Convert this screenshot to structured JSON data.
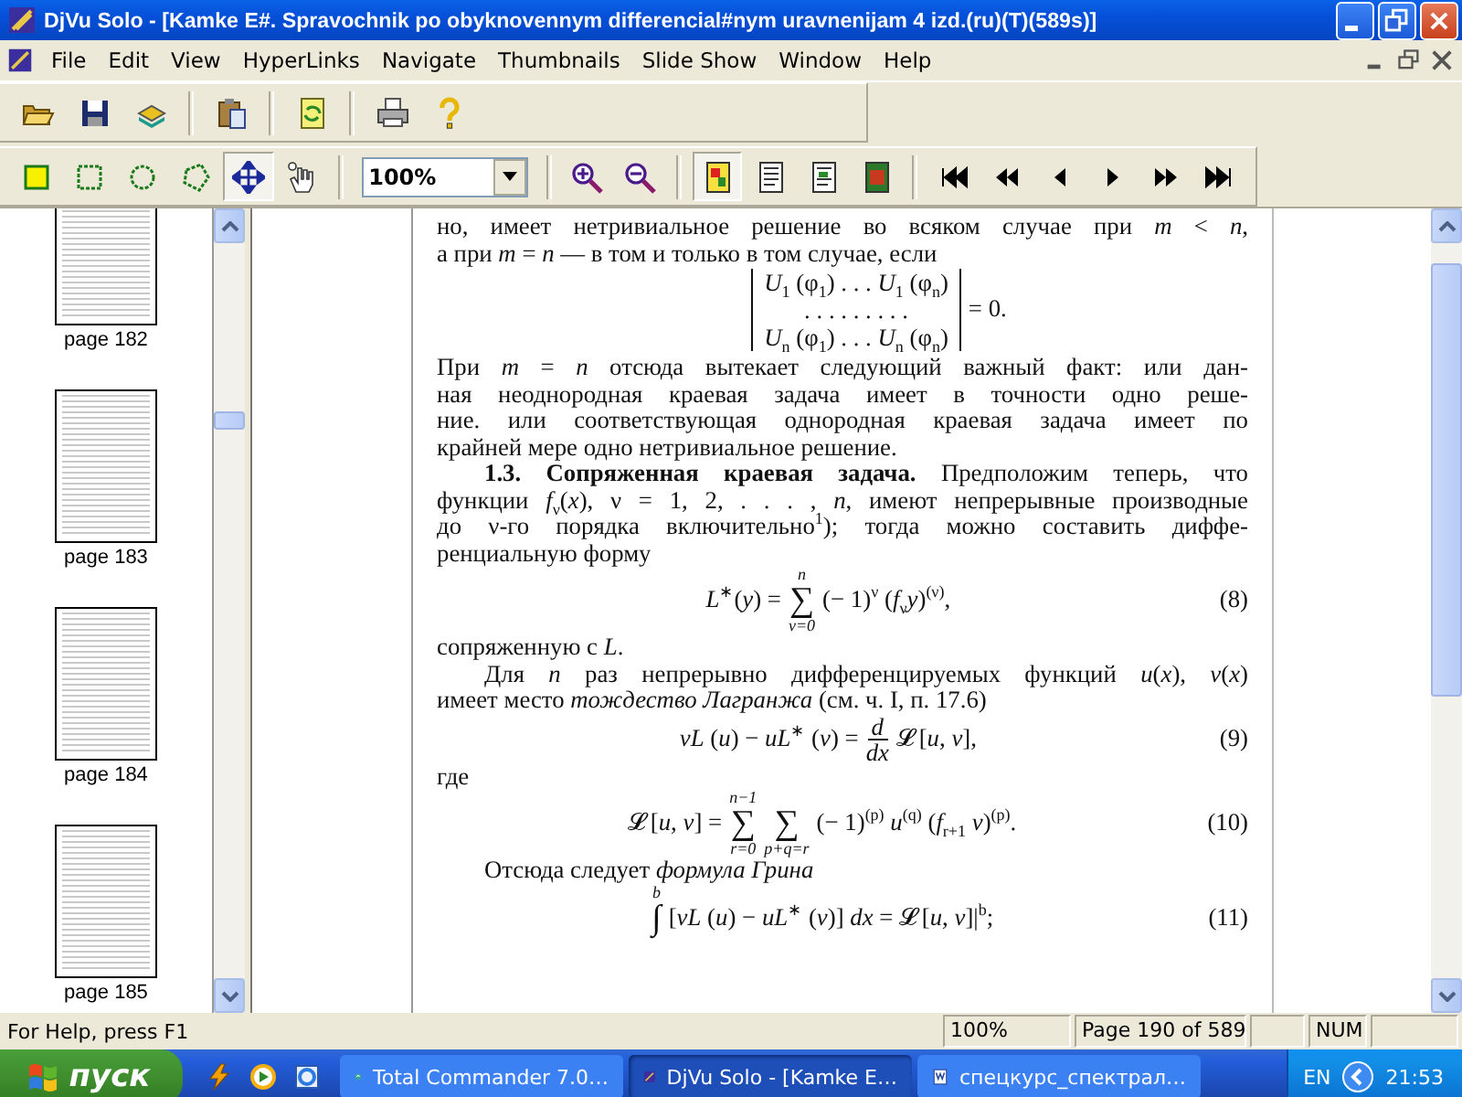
{
  "window": {
    "title": "DjVu Solo - [Kamke E#. Spravochnik po obyknovennym differencial#nym uravnenijam 4 izd.(ru)(T)(589s)]"
  },
  "menu": [
    "File",
    "Edit",
    "View",
    "HyperLinks",
    "Navigate",
    "Thumbnails",
    "Slide Show",
    "Window",
    "Help"
  ],
  "tools": [
    {
      "selected": false
    },
    {
      "selected": false
    },
    {
      "selected": false
    },
    {
      "selected": false
    },
    {
      "selected": true
    },
    {
      "selected": false
    }
  ],
  "zoom_box": {
    "value": "100%"
  },
  "view_modes": [
    {
      "selected": true
    },
    {
      "selected": false
    },
    {
      "selected": false
    },
    {
      "selected": false
    }
  ],
  "thumbnails": [
    {
      "label": "page 182"
    },
    {
      "label": "page 183"
    },
    {
      "label": "page 184"
    },
    {
      "label": "page 185"
    }
  ],
  "document": {
    "blocks": [
      {
        "kind": "para",
        "indent": false,
        "lines": [
          "но, имеет нетривиальное решение во всяком случае при *m* < *n*,",
          "а при *m* = *n* — в том и только в том случае, если"
        ]
      },
      {
        "kind": "det",
        "rows": [
          "*U*$_{1}$ (φ$_{1}$) . . . *U*$_{1}$ (φ$_{n}$)",
          ". . . . . . . . .",
          "*U*$_{n}$ (φ$_{1}$) . . . *U*$_{n}$ (φ$_{n}$)"
        ],
        "after": "= 0."
      },
      {
        "kind": "para",
        "indent": false,
        "lines": [
          "При *m* = *n* отсюда вытекает следующий важный факт: или дан-",
          "ная неоднородная краевая задача имеет в точности одно реше-",
          "ние. или соответствующая однородная краевая задача имеет по",
          "крайней мере одно нетривиальное решение."
        ]
      },
      {
        "kind": "para",
        "indent": true,
        "lines": [
          "**1.3. Сопряженная краевая задача.** Предположим теперь, что",
          "функции *f*$_{ν}$(*x*), ν = 1, 2, . . . , *n*, имеют непрерывные производные",
          "до ν-го порядка включительно$^{1}$); тогда можно составить диффе-",
          "ренциальную форму"
        ]
      },
      {
        "kind": "formula",
        "number": "(8)",
        "segs": [
          {
            "kind": "text",
            "text": "*L*$^{∗}$(*y*) ="
          },
          {
            "kind": "op",
            "symbol": "∑",
            "over": "n",
            "under": "ν=0"
          },
          {
            "kind": "text",
            "text": "(− 1)$^{ν}$ (*f*$_{ν}$*y*)$^{(ν)}$,"
          }
        ]
      },
      {
        "kind": "para",
        "indent": false,
        "lines": [
          "сопряженную с *L*."
        ]
      },
      {
        "kind": "para",
        "indent": true,
        "lines": [
          "Для *n* раз непрерывно дифференцируемых функций *u*(*x*), *v*(*x*)",
          "имеет место *тождество Лагранжа* (см. ч. I, п. 17.6)"
        ]
      },
      {
        "kind": "formula",
        "number": "(9)",
        "segs": [
          {
            "kind": "text",
            "text": "*vL* (*u*) − *uL*$^{∗}$ (*v*) ="
          },
          {
            "kind": "frac",
            "num": "d",
            "den": "dx"
          },
          {
            "kind": "text",
            "text": "𝓛 [*u*,  *v*],"
          }
        ]
      },
      {
        "kind": "para",
        "indent": false,
        "lines": [
          "где"
        ]
      },
      {
        "kind": "formula",
        "number": "(10)",
        "segs": [
          {
            "kind": "text",
            "text": "𝓛 [*u*,  *v*] ="
          },
          {
            "kind": "op",
            "symbol": "∑",
            "over": "n−1",
            "under": "r=0"
          },
          {
            "kind": "op",
            "symbol": "∑",
            "under": "p+q=r"
          },
          {
            "kind": "text",
            "text": "(− 1)$^{(p)}$ *u*$^{(q)}$ (*f*$_{r+1}$ *v*)$^{(p)}$."
          }
        ]
      },
      {
        "kind": "para",
        "indent": true,
        "lines": [
          "Отсюда следует *формула Грина*"
        ]
      },
      {
        "kind": "formula",
        "number": "(11)",
        "segs": [
          {
            "kind": "op",
            "symbol": "∫",
            "over": "b"
          },
          {
            "kind": "text",
            "text": "[*vL* (*u*) − *uL*$^{∗}$ (*v*)] *dx* = 𝓛 [*u*,  *v*]|$^{b}$;"
          }
        ]
      }
    ]
  },
  "status_bar": {
    "help": "For Help, press F1",
    "zoom": "100%",
    "page": "Page 190 of 589",
    "num": "NUM"
  },
  "taskbar": {
    "start": "пуск",
    "tasks": [
      {
        "label": "Total Commander 7.0…",
        "selected": false
      },
      {
        "label": "DjVu Solo - [Kamke E…",
        "selected": true
      },
      {
        "label": "спецкурс_спектрал…",
        "selected": false
      }
    ],
    "language": "EN",
    "clock": "21:53"
  }
}
